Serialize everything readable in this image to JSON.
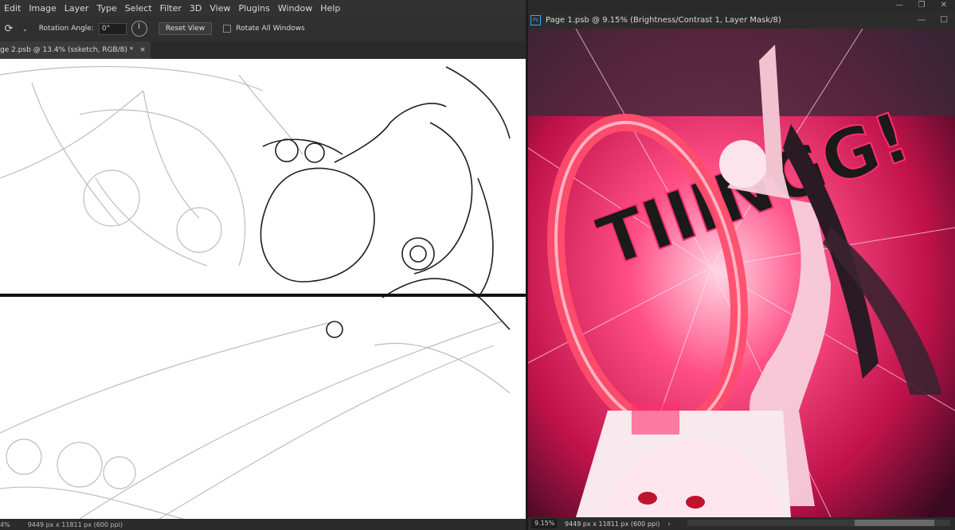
{
  "menu": [
    "Edit",
    "Image",
    "Layer",
    "Type",
    "Select",
    "Filter",
    "3D",
    "View",
    "Plugins",
    "Window",
    "Help"
  ],
  "options": {
    "rotation_label": "Rotation Angle:",
    "rotation_value": "0°",
    "reset_button": "Reset View",
    "rotate_all_label": "Rotate All Windows"
  },
  "left_doc": {
    "tab_title": "ge 2.psb @ 13.4% (ssketch, RGB/8) *",
    "close": "×",
    "zoom": "4%",
    "dims": "9449 px x 11811 px (600 ppi)"
  },
  "right_doc": {
    "title": "Page 1.psb @ 9.15% (Brightness/Contrast 1, Layer Mask/8)",
    "ps_icon": "Ps",
    "zoom": "9.15%",
    "dims": "9449 px x 11811 px (600 ppi)",
    "artwork_text": "TIIINGG!"
  },
  "colors": {
    "accent_pink": "#ff2f6e",
    "ps_blue": "#31a8ff"
  }
}
